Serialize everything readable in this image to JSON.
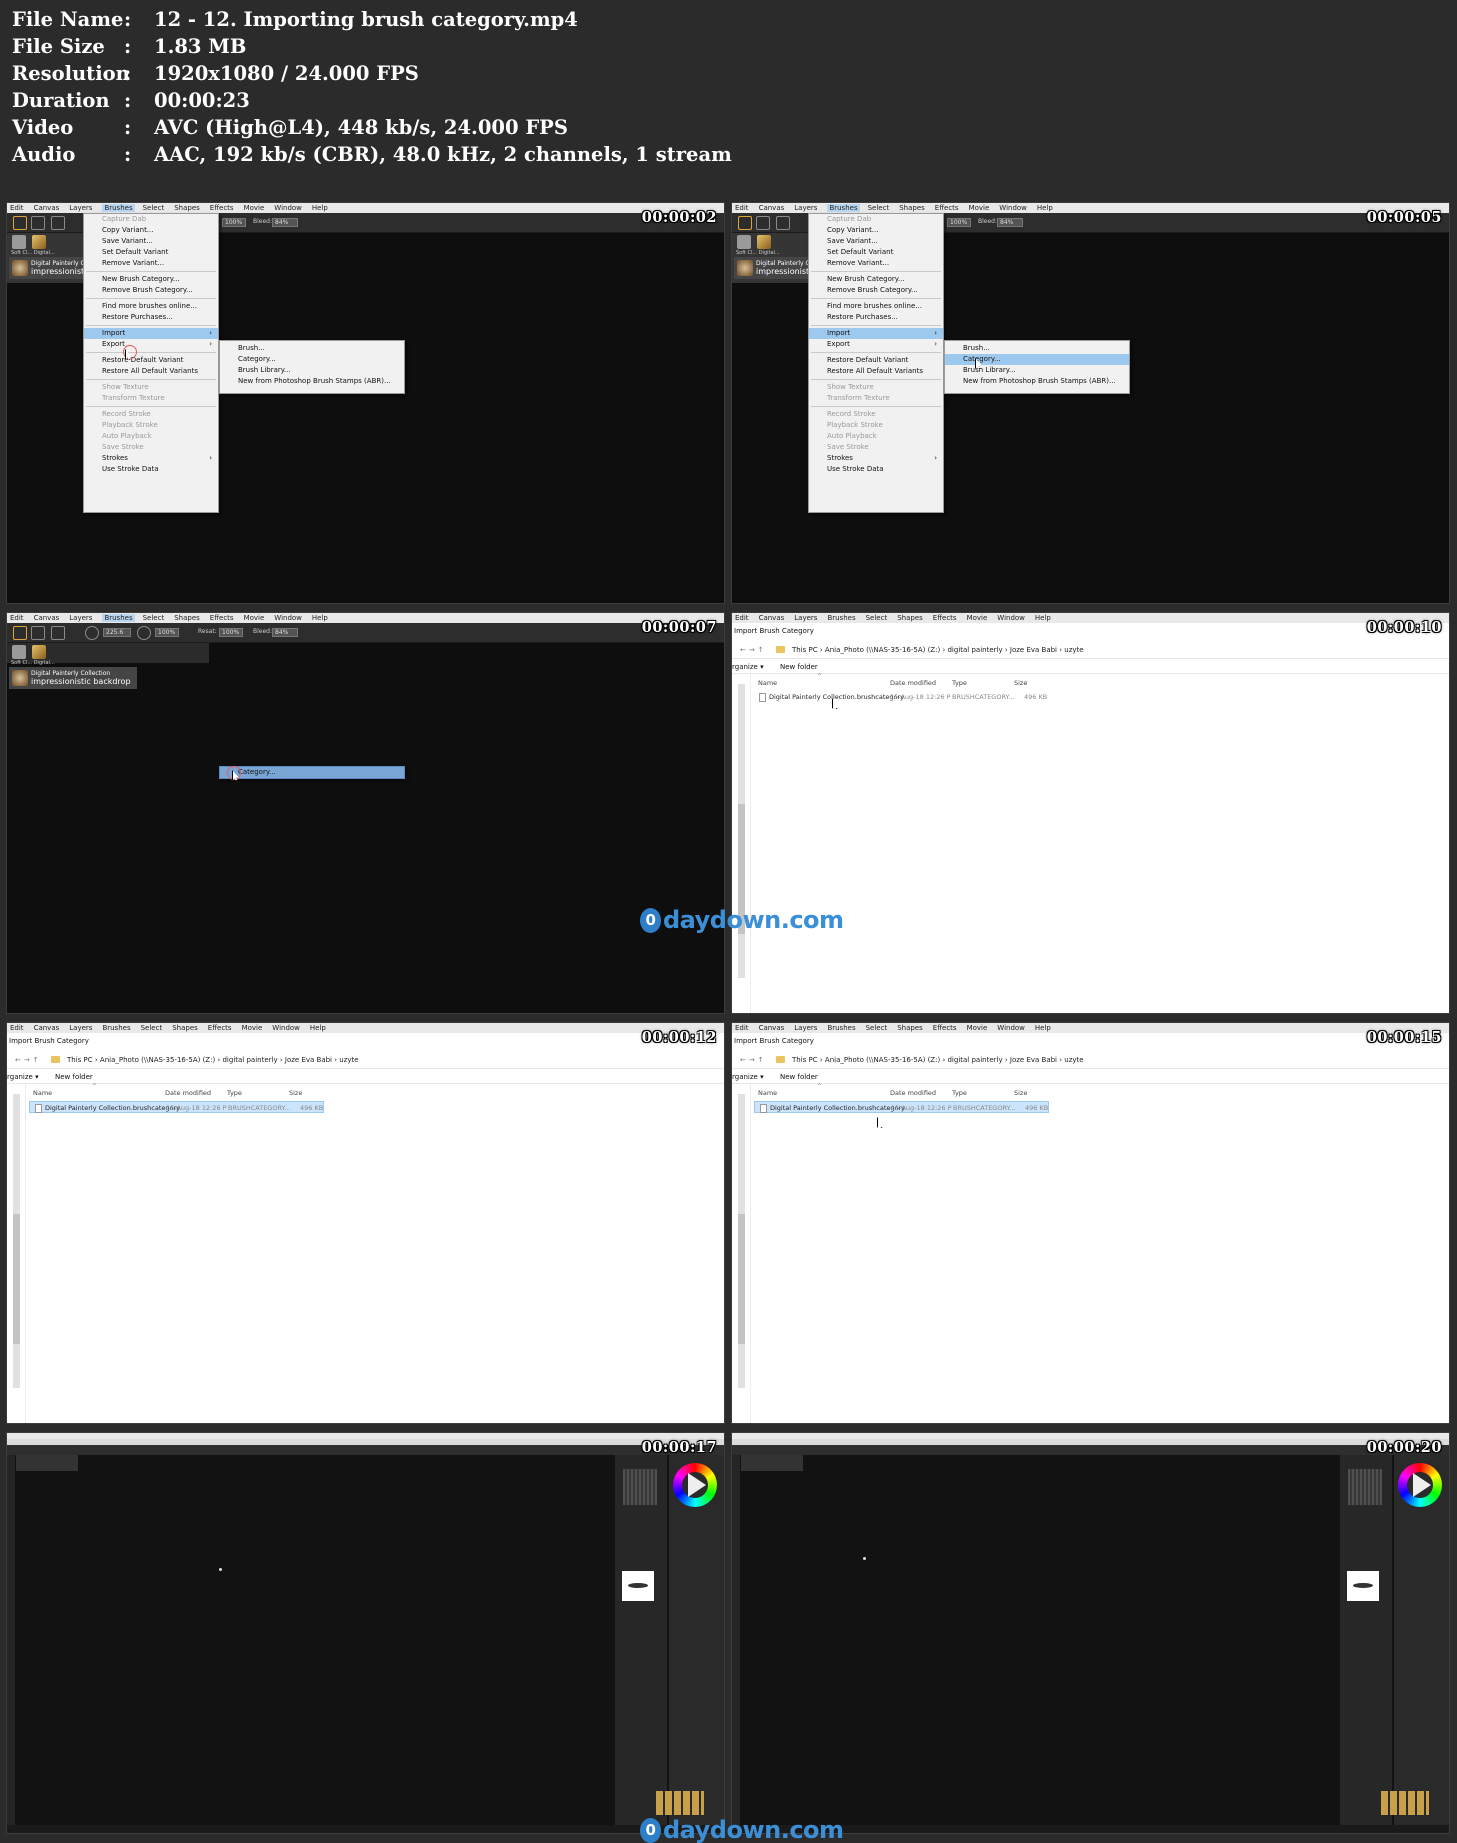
{
  "info": [
    {
      "key": "File Name",
      "value": "12 - 12. Importing brush category.mp4"
    },
    {
      "key": "File Size",
      "value": "1.83 MB"
    },
    {
      "key": "Resolution",
      "value": "1920x1080 / 24.000 FPS"
    },
    {
      "key": "Duration",
      "value": "00:00:23"
    },
    {
      "key": "Video",
      "value": "AVC (High@L4), 448 kb/s, 24.000 FPS"
    },
    {
      "key": "Audio",
      "value": "AAC, 192 kb/s (CBR), 48.0 kHz, 2 channels, 1 stream"
    }
  ],
  "separator": ":",
  "timestamps": [
    "00:00:02",
    "00:00:05",
    "00:00:07",
    "00:00:10",
    "00:00:12",
    "00:00:15",
    "00:00:17",
    "00:00:20"
  ],
  "menubar": [
    "Edit",
    "Canvas",
    "Layers",
    "Brushes",
    "Select",
    "Shapes",
    "Effects",
    "Movie",
    "Window",
    "Help"
  ],
  "toolbar": {
    "zoom": "100%",
    "bleed_label": "Bleed:",
    "bleed": "84%",
    "size": "225.6",
    "resat_label": "Resat:"
  },
  "brush_panel": {
    "cap1": "Soft Cl...",
    "cap2": "Digital...",
    "variant_top": "Digital Painterly Collection",
    "variant_short": "Digital Painterly Co",
    "variant_name": "impressionistic backdrop",
    "variant_name_short": "impressionistic"
  },
  "brushes_menu": [
    {
      "label": "Capture Dab",
      "disabled": true
    },
    {
      "label": "Copy Variant..."
    },
    {
      "label": "Save Variant..."
    },
    {
      "label": "Set Default Variant"
    },
    {
      "label": "Remove Variant..."
    },
    {
      "sep": true
    },
    {
      "label": "New Brush Category..."
    },
    {
      "label": "Remove Brush Category..."
    },
    {
      "sep": true
    },
    {
      "label": "Find more brushes online..."
    },
    {
      "label": "Restore Purchases..."
    },
    {
      "sep": true
    },
    {
      "label": "Import",
      "submenu": true,
      "highlight": true
    },
    {
      "label": "Export",
      "submenu": true
    },
    {
      "sep": true
    },
    {
      "label": "Restore Default Variant"
    },
    {
      "label": "Restore All Default Variants"
    },
    {
      "sep": true
    },
    {
      "label": "Show Texture",
      "disabled": true
    },
    {
      "label": "Transform Texture",
      "disabled": true
    },
    {
      "sep": true
    },
    {
      "label": "Record Stroke",
      "disabled": true
    },
    {
      "label": "Playback Stroke",
      "disabled": true
    },
    {
      "label": "Auto Playback",
      "disabled": true
    },
    {
      "label": "Save Stroke",
      "disabled": true
    },
    {
      "label": "Strokes",
      "submenu": true
    },
    {
      "label": "Use Stroke Data"
    }
  ],
  "import_submenu": [
    "Brush...",
    "Category...",
    "Brush Library...",
    "New from Photoshop Brush Stamps (ABR)..."
  ],
  "dialog": {
    "title": "Import Brush Category",
    "path": [
      "This PC",
      "Ania_Photo (\\\\NAS-35-16-5A) (Z:)",
      "digital painterly",
      "Joze Eva Babi",
      "uzyte"
    ],
    "organize": "rganize ▾",
    "new_folder": "New folder",
    "columns": [
      "Name",
      "Date modified",
      "Type",
      "Size"
    ],
    "file": {
      "name": "Digital Painterly Collection.brushcategory",
      "date": "15-Aug-18 12:26 P",
      "type": "BRUSHCATEGORY...",
      "size": "496 KB"
    }
  },
  "watermark": {
    "badge": "0",
    "text": "daydown.com"
  },
  "colors": {
    "background": "#2b2b2b",
    "highlight": "#9ec9ef",
    "watermark": "#3b8fd6"
  }
}
